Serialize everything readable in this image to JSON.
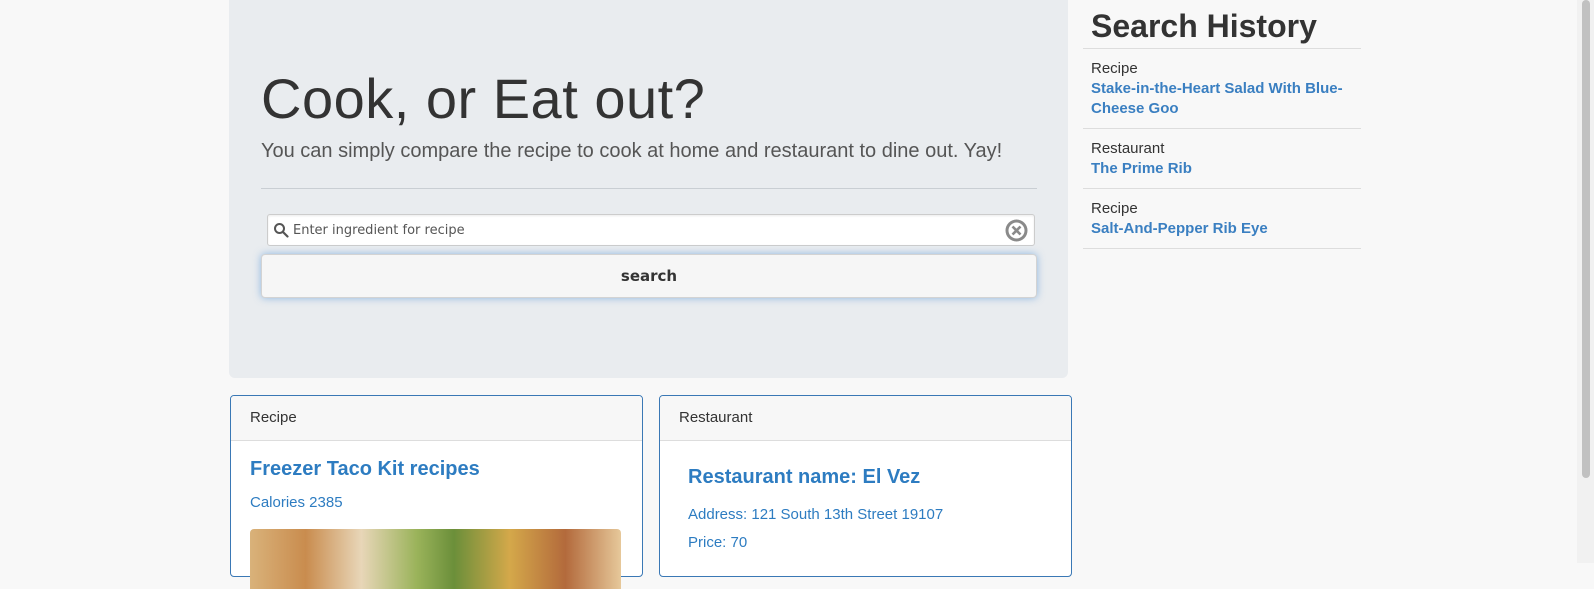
{
  "hero": {
    "title": "Cook, or Eat out?",
    "subtitle": "You can simply compare the recipe to cook at home and restaurant to dine out. Yay!",
    "search": {
      "placeholder": "Enter ingredient for recipe",
      "value": ""
    },
    "search_button_label": "search"
  },
  "recipe_card": {
    "header": "Recipe",
    "title": "Freezer Taco Kit recipes",
    "calories": "Calories 2385"
  },
  "restaurant_card": {
    "header": "Restaurant",
    "name": "Restaurant name: El Vez",
    "address": "Address: 121 South 13th Street 19107",
    "price": "Price: 70"
  },
  "sidebar": {
    "title": "Search History",
    "items": [
      {
        "type": "Recipe",
        "name": "Stake-in-the-Heart Salad With Blue-Cheese Goo"
      },
      {
        "type": "Restaurant",
        "name": "The Prime Rib"
      },
      {
        "type": "Recipe",
        "name": "Salt-And-Pepper Rib Eye"
      }
    ]
  },
  "colors": {
    "accent": "#2d7cc1",
    "card_border": "#3a78b5",
    "hero_bg": "#e9ecef"
  }
}
